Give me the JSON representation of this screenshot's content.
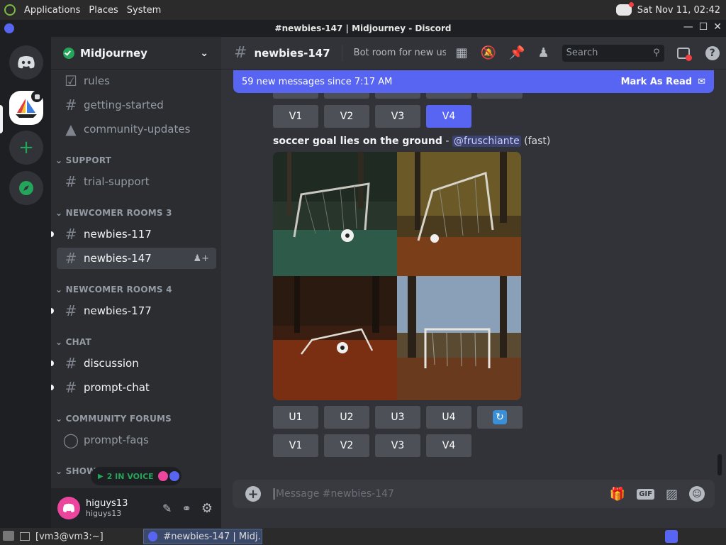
{
  "os": {
    "menu": [
      "Applications",
      "Places",
      "System"
    ],
    "datetime": "Sat Nov 11, 02:42"
  },
  "window": {
    "title": "#newbies-147 | Midjourney - Discord"
  },
  "server": {
    "name": "Midjourney"
  },
  "channels": {
    "top": [
      {
        "name": "rules",
        "icon": "rules-icon"
      },
      {
        "name": "getting-started",
        "icon": "hash-icon"
      },
      {
        "name": "community-updates",
        "icon": "megaphone-icon"
      }
    ],
    "categories": [
      {
        "label": "SUPPORT",
        "items": [
          {
            "name": "trial-support"
          }
        ]
      },
      {
        "label": "NEWCOMER ROOMS 3",
        "items": [
          {
            "name": "newbies-117"
          },
          {
            "name": "newbies-147"
          }
        ]
      },
      {
        "label": "NEWCOMER ROOMS 4",
        "items": [
          {
            "name": "newbies-177"
          }
        ]
      },
      {
        "label": "CHAT",
        "items": [
          {
            "name": "discussion"
          },
          {
            "name": "prompt-chat"
          }
        ]
      },
      {
        "label": "COMMUNITY FORUMS",
        "items": [
          {
            "name": "prompt-faqs"
          }
        ]
      },
      {
        "label": "SHOWC",
        "items": []
      }
    ]
  },
  "voice": {
    "label": "2 IN VOICE"
  },
  "user": {
    "name": "higuys13",
    "tag": "higuys13"
  },
  "header": {
    "channel": "newbies-147",
    "topic": "Bot room for new us...",
    "search_placeholder": "Search"
  },
  "banner": {
    "text": "59 new messages since 7:17 AM",
    "action": "Mark As Read"
  },
  "message": {
    "prompt": "soccer goal lies on the ground",
    "separator": " - ",
    "mention": "@fruschiante",
    "mode": "(fast)",
    "upscale_buttons": [
      "U1",
      "U2",
      "U3",
      "U4"
    ],
    "variation_buttons": [
      "V1",
      "V2",
      "V3",
      "V4"
    ],
    "prev_variation_buttons": [
      "V1",
      "V2",
      "V3",
      "V4"
    ]
  },
  "composer": {
    "placeholder": "Message #newbies-147",
    "gif_label": "GIF"
  },
  "taskbar": {
    "items": [
      "[vm3@vm3:~]",
      "#newbies-147 | Midj..."
    ]
  },
  "colors": {
    "accent": "#5865f2",
    "online": "#23a55a",
    "background": "#313338"
  }
}
